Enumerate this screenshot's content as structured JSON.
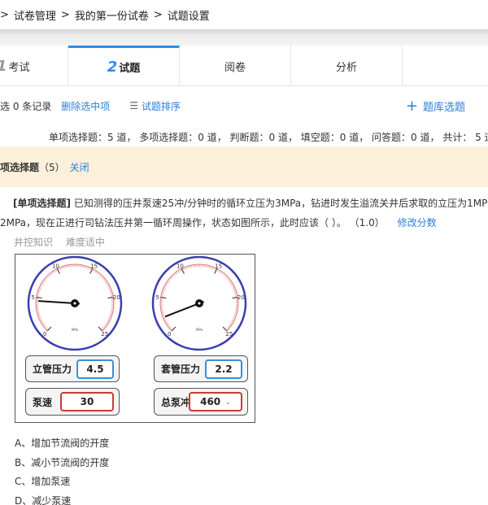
{
  "breadcrumb": {
    "items": [
      "试卷管理",
      "我的第一份试卷",
      "试题设置"
    ],
    "separator": ">"
  },
  "tabs": [
    {
      "num": "1",
      "label": "考试"
    },
    {
      "num": "2",
      "label": "试题"
    },
    {
      "num": "",
      "label": "阅卷"
    },
    {
      "num": "",
      "label": "分析"
    }
  ],
  "toolbar": {
    "selected_text": "选 0 条记录",
    "delete_selected": "删除选中项",
    "sort_label": "试题排序",
    "bank_select": "题库选题"
  },
  "summary": "单项选择题：5 道， 多项选择题：0 道， 判断题：0 道， 填空题：0 道， 问答题：0 道， 共计： 5 道",
  "section": {
    "title": "项选择题",
    "count": "（5）",
    "close_label": "关闭"
  },
  "question": {
    "type_label": "[单项选择题]",
    "line1": "已知测得的压井泵速25冲/分钟时的循环立压为3MPa，钻进时发生溢流关井后求取的立压为1MP",
    "line2": "2MPa，现在正进行司钻法压井第一循环周操作，状态如图所示，此时应该（ ）。 （1.0）",
    "edit_score": "修改分数",
    "tags": [
      "井控知识",
      "难度适中"
    ]
  },
  "figure": {
    "gauges": [
      {
        "ticks": [
          "10",
          "15",
          "5",
          "20",
          "0",
          "25"
        ],
        "unit": "MPa",
        "reading": 4.5
      },
      {
        "ticks": [
          "10",
          "15",
          "5",
          "20",
          "0",
          "25"
        ],
        "unit": "MPa",
        "reading": 2.2
      }
    ],
    "panels": [
      {
        "label": "立管压力",
        "value": "4.5"
      },
      {
        "label": "套管压力",
        "value": "2.2"
      },
      {
        "label": "泵速",
        "value": "30"
      },
      {
        "label": "总泵冲",
        "value": "460"
      }
    ]
  },
  "options": [
    "A、增加节流阀的开度",
    "B、减小节流阀的开度",
    "C、增加泵速",
    "D、减少泵速"
  ],
  "colors": {
    "accent": "#2b8ee6",
    "link": "#2b7fd6",
    "section_bg": "#fdf0db",
    "dial_ring": "#3b3fb0",
    "needle": "#111111"
  }
}
